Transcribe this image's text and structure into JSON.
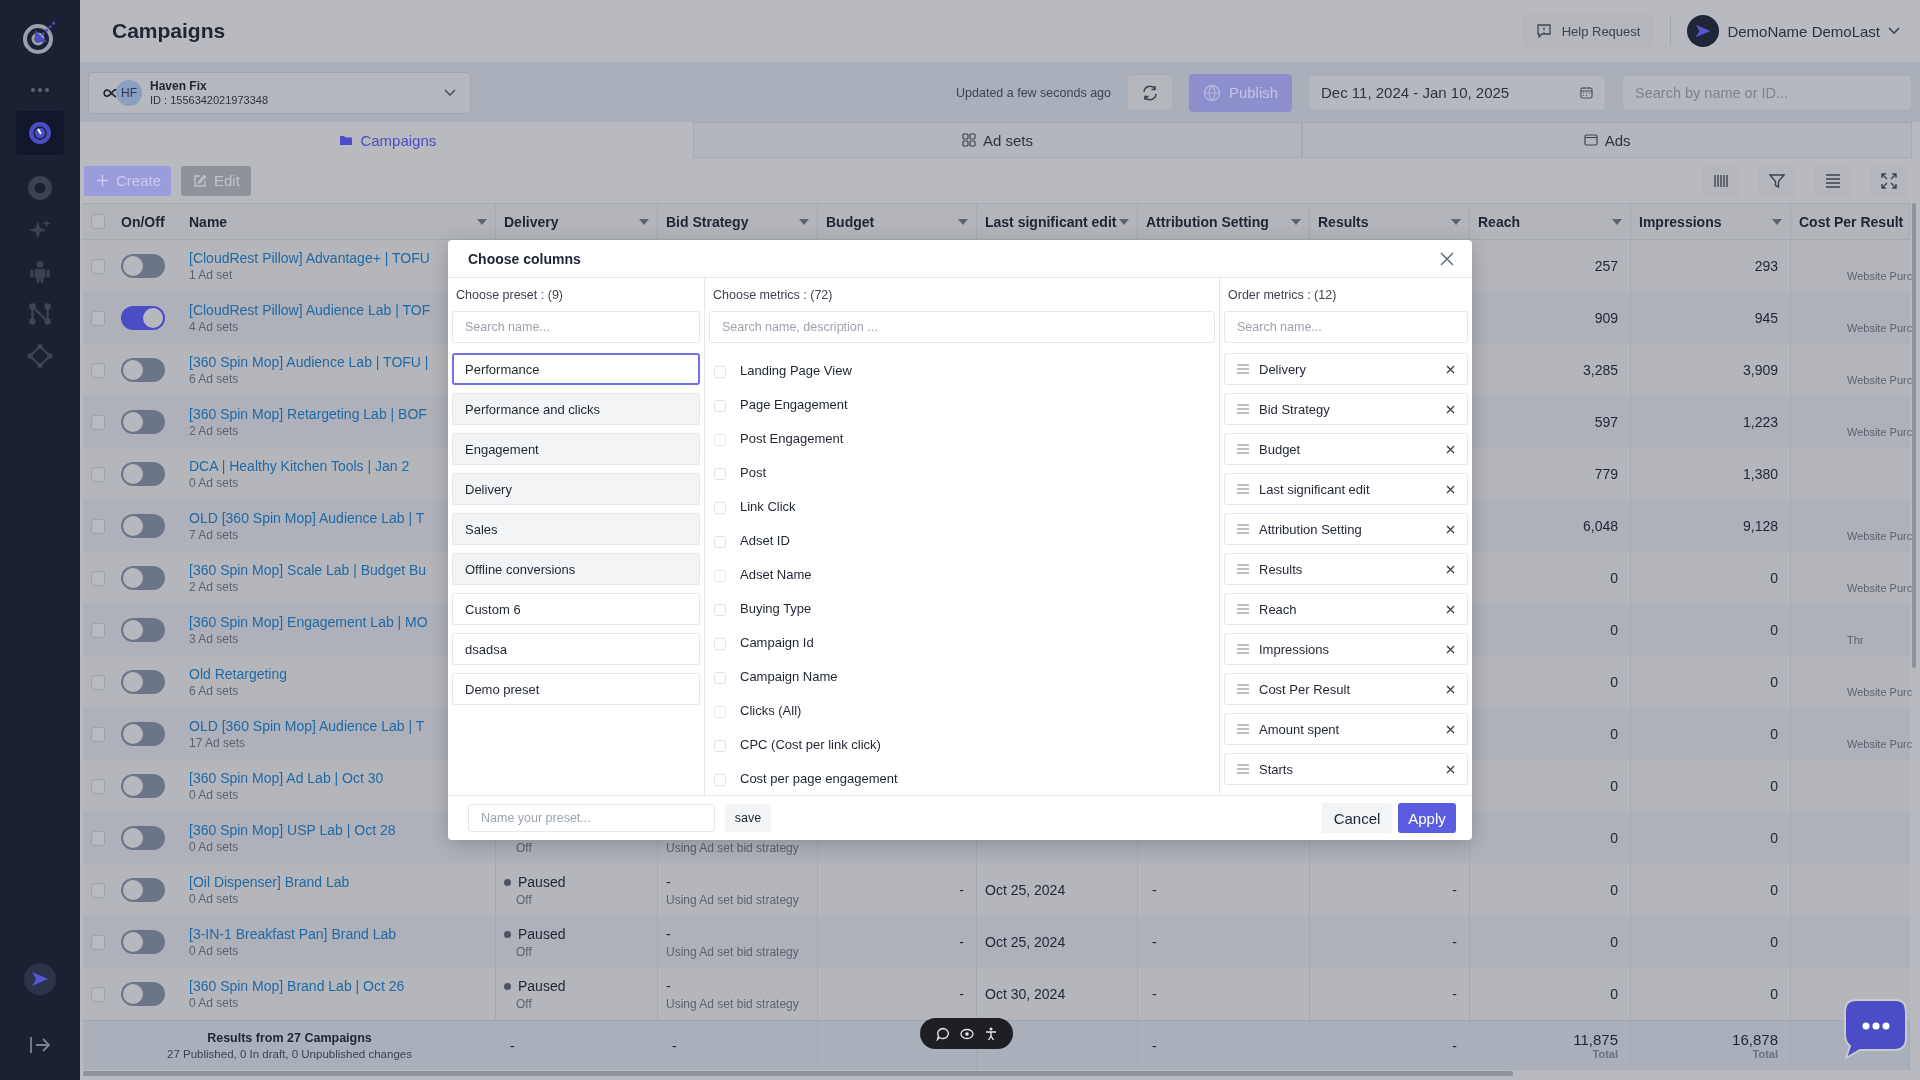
{
  "header": {
    "title": "Campaigns",
    "help_button": "Help Request",
    "user_name": "DemoName DemoLast"
  },
  "account": {
    "avatar": "HF",
    "name": "Haven Fix",
    "id": "ID : 1556342021973348"
  },
  "toolbar": {
    "updated": "Updated a few seconds ago",
    "publish": "Publish",
    "date_range": "Dec 11, 2024 - Jan 10, 2025",
    "search": {
      "placeholder": "Search by name or ID..."
    }
  },
  "tabs": [
    {
      "label": "Campaigns",
      "selected": true
    },
    {
      "label": "Ad sets",
      "selected": false
    },
    {
      "label": "Ads",
      "selected": false
    }
  ],
  "actions": {
    "create": "Create",
    "edit": "Edit"
  },
  "table": {
    "header_checked": false,
    "columns": [
      {
        "label": "On/Off",
        "sortable": false
      },
      {
        "label": "Name",
        "sortable": true
      },
      {
        "label": "Delivery",
        "sortable": true
      },
      {
        "label": "Bid Strategy",
        "sortable": true
      },
      {
        "label": "Budget",
        "sortable": true
      },
      {
        "label": "Last significant edit",
        "sortable": true
      },
      {
        "label": "Attribution Setting",
        "sortable": true
      },
      {
        "label": "Results",
        "sortable": true
      },
      {
        "label": "Reach",
        "sortable": true
      },
      {
        "label": "Impressions",
        "sortable": true
      },
      {
        "label": "Cost Per Result",
        "sortable": false
      }
    ],
    "rows": [
      {
        "checked": false,
        "on": false,
        "name": "[CloudRest Pillow] Advantage+ | TOFU",
        "ad_sets": "1 Ad set",
        "reach": "257",
        "impressions": "293",
        "cost_per_result": "Website Purc"
      },
      {
        "checked": false,
        "on": true,
        "name": "[CloudRest Pillow] Audience Lab | TOF",
        "ad_sets": "4 Ad sets",
        "reach": "909",
        "impressions": "945",
        "cost_per_result": "Website Purc"
      },
      {
        "checked": false,
        "on": false,
        "name": "[360 Spin Mop] Audience Lab | TOFU |",
        "ad_sets": "6 Ad sets",
        "reach": "3,285",
        "impressions": "3,909",
        "cost_per_result": "Website Purc"
      },
      {
        "checked": false,
        "on": false,
        "name": "[360 Spin Mop] Retargeting Lab | BOF",
        "ad_sets": "2 Ad sets",
        "reach": "597",
        "impressions": "1,223",
        "cost_per_result": "Website Purc"
      },
      {
        "checked": false,
        "on": false,
        "name": "DCA | Healthy Kitchen Tools | Jan 2",
        "ad_sets": "0 Ad sets",
        "reach": "779",
        "impressions": "1,380"
      },
      {
        "checked": false,
        "on": false,
        "name": "OLD [360 Spin Mop] Audience Lab | T",
        "ad_sets": "7 Ad sets",
        "reach": "6,048",
        "impressions": "9,128",
        "cost_per_result": "Website Purc"
      },
      {
        "checked": false,
        "on": false,
        "name": "[360 Spin Mop] Scale Lab | Budget Bu",
        "ad_sets": "2 Ad sets",
        "reach": "0",
        "impressions": "0",
        "cost_per_result": "Website Purc"
      },
      {
        "checked": false,
        "on": false,
        "name": "[360 Spin Mop] Engagement Lab | MO",
        "ad_sets": "3 Ad sets",
        "reach": "0",
        "impressions": "0",
        "cost_per_result": "Thr"
      },
      {
        "checked": false,
        "on": false,
        "name": "Old Retargeting",
        "ad_sets": "6 Ad sets",
        "reach": "0",
        "impressions": "0",
        "cost_per_result": "Website Purc"
      },
      {
        "checked": false,
        "on": false,
        "name": "OLD [360 Spin Mop] Audience Lab | T",
        "ad_sets": "17 Ad sets",
        "reach": "0",
        "impressions": "0",
        "cost_per_result": "Website Purc"
      },
      {
        "checked": false,
        "on": false,
        "name": "[360 Spin Mop] Ad Lab | Oct 30",
        "ad_sets": "0 Ad sets",
        "reach": "0",
        "impressions": "0"
      },
      {
        "checked": false,
        "on": false,
        "name": "[360 Spin Mop] USP Lab | Oct 28",
        "ad_sets": "0 Ad sets",
        "delivery_sub": "Off",
        "bid_sub": "Using Ad set bid strategy",
        "reach": "0",
        "impressions": "0"
      },
      {
        "checked": false,
        "on": false,
        "name": "[Oil Dispenser] Brand Lab",
        "ad_sets": "0 Ad sets",
        "delivery": "Paused",
        "delivery_sub": "Off",
        "bid": "-",
        "bid_sub": "Using Ad set bid strategy",
        "budget": "-",
        "last_edit": "Oct 25, 2024",
        "attribution": "-",
        "results": "-",
        "reach": "0",
        "impressions": "0"
      },
      {
        "checked": false,
        "on": false,
        "name": "[3-IN-1 Breakfast Pan] Brand Lab",
        "ad_sets": "0 Ad sets",
        "delivery": "Paused",
        "delivery_sub": "Off",
        "bid": "-",
        "bid_sub": "Using Ad set bid strategy",
        "budget": "-",
        "last_edit": "Oct 25, 2024",
        "attribution": "-",
        "results": "-",
        "reach": "0",
        "impressions": "0"
      },
      {
        "checked": false,
        "on": false,
        "name": "[360 Spin Mop] Brand Lab | Oct 26",
        "ad_sets": "0 Ad sets",
        "delivery": "Paused",
        "delivery_sub": "Off",
        "bid": "-",
        "bid_sub": "Using Ad set bid strategy",
        "budget": "-",
        "last_edit": "Oct 30, 2024",
        "attribution": "-",
        "results": "-",
        "reach": "0",
        "impressions": "0"
      }
    ],
    "footer": {
      "title": "Results from 27 Campaigns",
      "summary": "27 Published, 0 In draft, 0 Unpublished changes",
      "delivery": "-",
      "bid": "-",
      "attribution": "-",
      "results": "-",
      "reach": "11,875",
      "reach_label": "Total",
      "impressions": "16,878",
      "impressions_label": "Total"
    }
  },
  "modal": {
    "title": "Choose columns",
    "presets": {
      "label": "Choose preset : (9)",
      "search": {
        "placeholder": "Search name..."
      },
      "items": [
        {
          "label": "Performance",
          "kind": "builtin",
          "selected": true
        },
        {
          "label": "Performance and clicks",
          "kind": "builtin",
          "selected": false
        },
        {
          "label": "Engagement",
          "kind": "builtin",
          "selected": false
        },
        {
          "label": "Delivery",
          "kind": "builtin",
          "selected": false
        },
        {
          "label": "Sales",
          "kind": "builtin",
          "selected": false
        },
        {
          "label": "Offline conversions",
          "kind": "builtin",
          "selected": false
        },
        {
          "label": "Custom 6",
          "kind": "custom",
          "selected": false
        },
        {
          "label": "dsadsa",
          "kind": "custom",
          "selected": false
        },
        {
          "label": "Demo preset",
          "kind": "custom",
          "selected": false
        }
      ]
    },
    "metrics": {
      "label": "Choose metrics : (72)",
      "search": {
        "placeholder": "Search name, description ..."
      },
      "items": [
        {
          "label": "Landing Page View",
          "checked": false
        },
        {
          "label": "Page Engagement",
          "checked": false
        },
        {
          "label": "Post Engagement",
          "checked": false
        },
        {
          "label": "Post",
          "checked": false
        },
        {
          "label": "Link Click",
          "checked": false
        },
        {
          "label": "Adset ID",
          "checked": false
        },
        {
          "label": "Adset Name",
          "checked": false
        },
        {
          "label": "Buying Type",
          "checked": false
        },
        {
          "label": "Campaign Id",
          "checked": false
        },
        {
          "label": "Campaign Name",
          "checked": false
        },
        {
          "label": "Clicks (All)",
          "checked": false
        },
        {
          "label": "CPC (Cost per link click)",
          "checked": false
        },
        {
          "label": "Cost per page engagement",
          "checked": false
        }
      ]
    },
    "order": {
      "label": "Order metrics : (12)",
      "search": {
        "placeholder": "Search name..."
      },
      "items": [
        "Delivery",
        "Bid Strategy",
        "Budget",
        "Last significant edit",
        "Attribution Setting",
        "Results",
        "Reach",
        "Impressions",
        "Cost Per Result",
        "Amount spent",
        "Starts"
      ]
    },
    "preset_name": {
      "placeholder": "Name your preset..."
    },
    "save": "save",
    "cancel": "Cancel",
    "apply": "Apply"
  }
}
